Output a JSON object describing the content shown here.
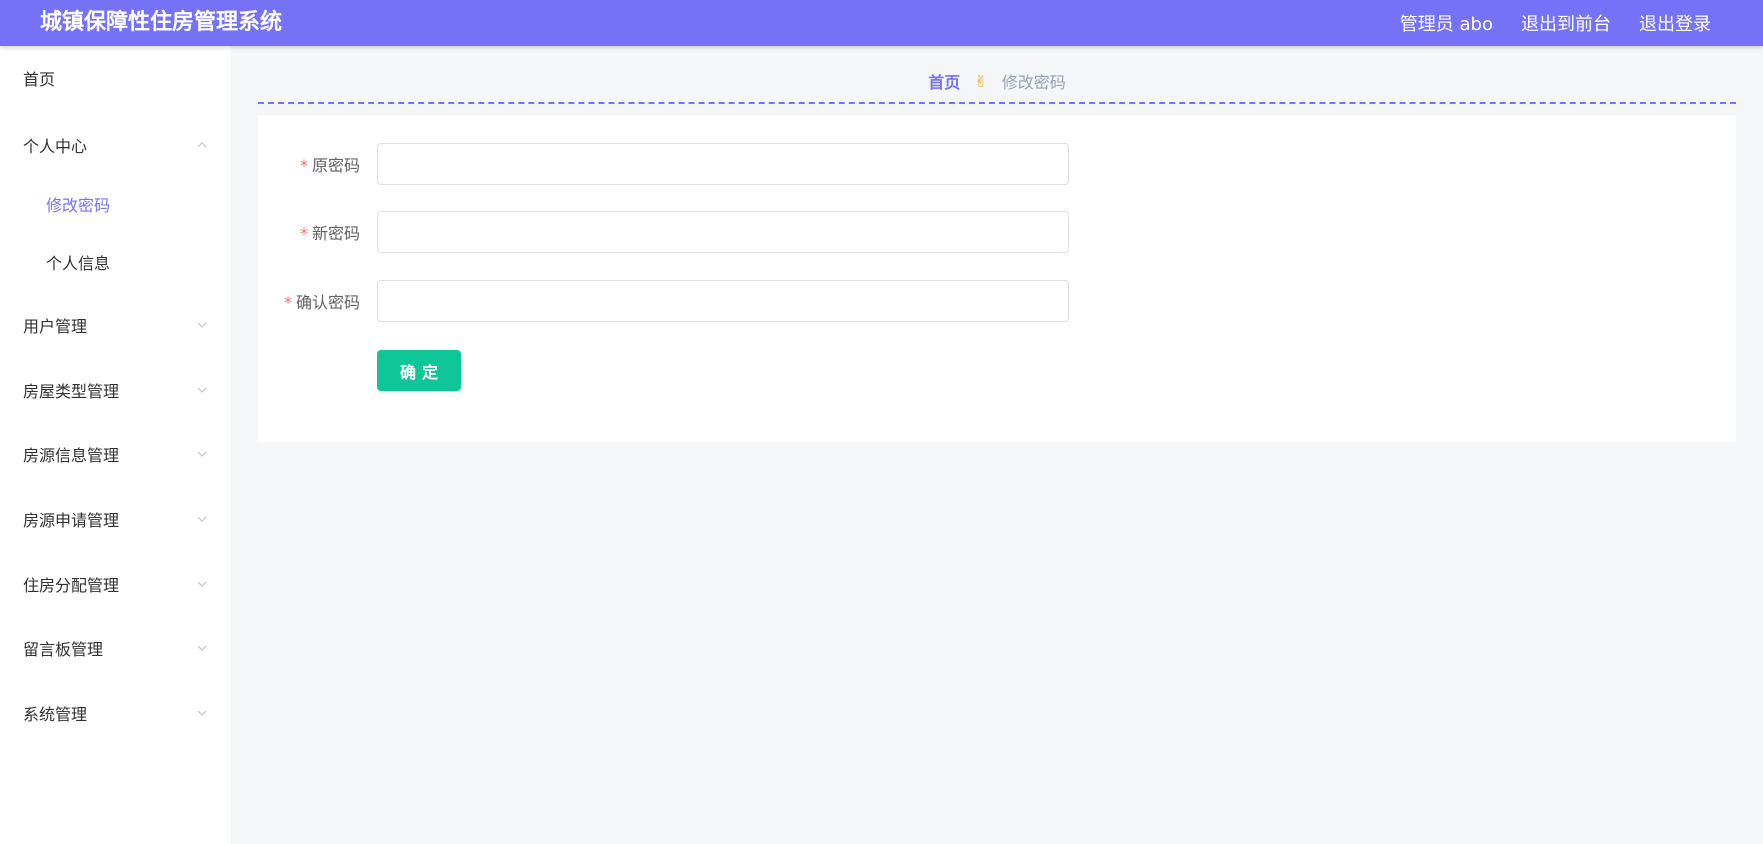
{
  "header": {
    "title": "城镇保障性住房管理系统",
    "links": [
      "管理员 abo",
      "退出到前台",
      "退出登录"
    ]
  },
  "sidebar": {
    "items": [
      {
        "label": "首页",
        "type": "top",
        "chevron": "none"
      },
      {
        "label": "个人中心",
        "type": "top",
        "chevron": "up"
      },
      {
        "label": "修改密码",
        "type": "sub",
        "active": true
      },
      {
        "label": "个人信息",
        "type": "sub"
      },
      {
        "label": "用户管理",
        "type": "top",
        "chevron": "down"
      },
      {
        "label": "房屋类型管理",
        "type": "top",
        "chevron": "down"
      },
      {
        "label": "房源信息管理",
        "type": "top",
        "chevron": "down"
      },
      {
        "label": "房源申请管理",
        "type": "top",
        "chevron": "down"
      },
      {
        "label": "住房分配管理",
        "type": "top",
        "chevron": "down"
      },
      {
        "label": "留言板管理",
        "type": "top",
        "chevron": "down"
      },
      {
        "label": "系统管理",
        "type": "top",
        "chevron": "down"
      }
    ]
  },
  "breadcrumb": {
    "home": "首页",
    "separator": "✌",
    "current": "修改密码"
  },
  "form": {
    "required_mark": "*",
    "fields": [
      {
        "label": "原密码",
        "value": "",
        "placeholder": ""
      },
      {
        "label": "新密码",
        "value": "",
        "placeholder": ""
      },
      {
        "label": "确认密码",
        "value": "",
        "placeholder": ""
      }
    ],
    "submit_label": "确定"
  },
  "colors": {
    "accent": "#7572f8",
    "button": "#0fc699",
    "required": "#f56c6c"
  }
}
